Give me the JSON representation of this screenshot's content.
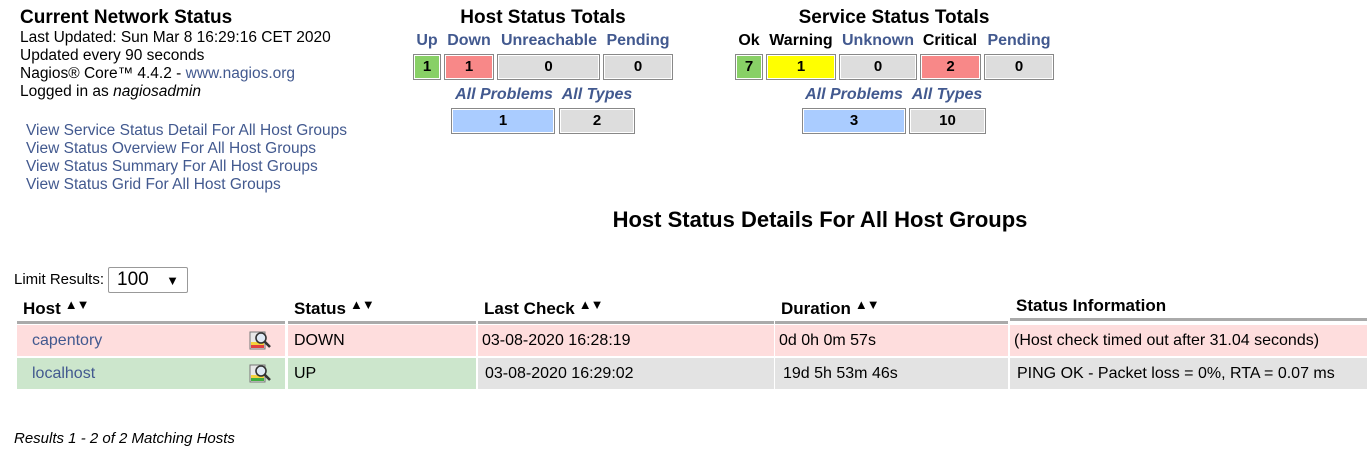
{
  "info": {
    "title": "Current Network Status",
    "last_updated": "Last Updated: Sun Mar 8 16:29:16 CET 2020",
    "update_interval": "Updated every 90 seconds",
    "version_prefix": "Nagios® Core™ 4.4.2 - ",
    "version_link": "www.nagios.org",
    "logged_prefix": "Logged in as ",
    "user": "nagiosadmin"
  },
  "links": [
    "View Service Status Detail For All Host Groups",
    "View Status Overview For All Host Groups",
    "View Status Summary For All Host Groups",
    "View Status Grid For All Host Groups"
  ],
  "host_totals": {
    "title": "Host Status Totals",
    "labels": {
      "up": "Up",
      "down": "Down",
      "unreachable": "Unreachable",
      "pending": "Pending"
    },
    "values": {
      "up": "1",
      "down": "1",
      "unreachable": "0",
      "pending": "0"
    },
    "problem_labels": {
      "all_problems": "All Problems",
      "all_types": "All Types"
    },
    "problem_values": {
      "all_problems": "1",
      "all_types": "2"
    }
  },
  "service_totals": {
    "title": "Service Status Totals",
    "labels": {
      "ok": "Ok",
      "warning": "Warning",
      "unknown": "Unknown",
      "critical": "Critical",
      "pending": "Pending"
    },
    "values": {
      "ok": "7",
      "warning": "1",
      "unknown": "0",
      "critical": "2",
      "pending": "0"
    },
    "problem_labels": {
      "all_problems": "All Problems",
      "all_types": "All Types"
    },
    "problem_values": {
      "all_problems": "3",
      "all_types": "10"
    }
  },
  "section_title": "Host Status Details For All Host Groups",
  "limit": {
    "label": "Limit Results:",
    "value": "100"
  },
  "table": {
    "columns": [
      "Host",
      "Status",
      "Last Check",
      "Duration",
      "Status Information"
    ],
    "rows": [
      {
        "host": "capentory",
        "status": "DOWN",
        "last_check": "03-08-2020 16:28:19",
        "duration": "0d 0h 0m 57s",
        "info": "(Host check timed out after 31.04 seconds)"
      },
      {
        "host": "localhost",
        "status": "UP",
        "last_check": "03-08-2020 16:29:02",
        "duration": "19d 5h 53m 46s",
        "info": "PING OK - Packet loss = 0%, RTA = 0.07 ms"
      }
    ]
  },
  "results": "Results 1 - 2 of 2 Matching Hosts",
  "colors": {
    "up": "#88d066",
    "down": "#f88888",
    "warning": "#ffff00",
    "neutral": "#dddddd",
    "problems": "#aaccff",
    "row_down": "#fedddd",
    "row_up": "#cce6cc",
    "link": "#42598f"
  }
}
